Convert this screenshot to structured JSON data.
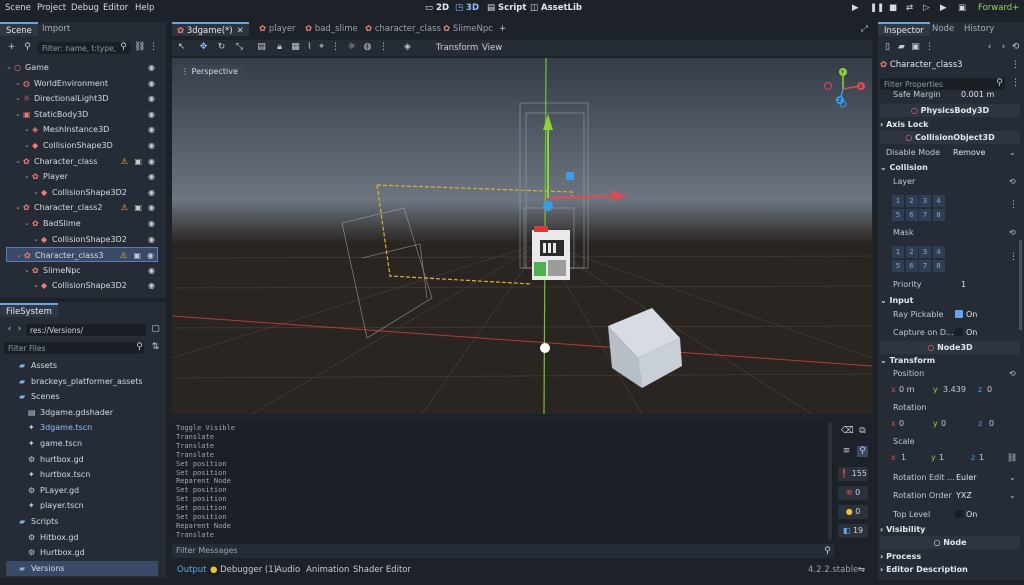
{
  "menu": {
    "items": [
      "Scene",
      "Project",
      "Debug",
      "Editor",
      "Help"
    ]
  },
  "center_buttons": {
    "b2d": "2D",
    "b3d": "3D",
    "script": "Script",
    "assetlib": "AssetLib"
  },
  "renderer": "Forward+",
  "scene_dock": {
    "tabs": [
      "Scene",
      "Import"
    ],
    "filter_placeholder": "Filter: name, t:type,",
    "tree": [
      {
        "label": "Game",
        "indent": 0,
        "icon": "○",
        "color": "#f07b7b"
      },
      {
        "label": "WorldEnvironment",
        "indent": 1,
        "icon": "◍",
        "color": "#f07b7b"
      },
      {
        "label": "DirectionalLight3D",
        "indent": 1,
        "icon": "☼",
        "color": "#f07b7b"
      },
      {
        "label": "StaticBody3D",
        "indent": 1,
        "icon": "▣",
        "color": "#f07b7b"
      },
      {
        "label": "MeshInstance3D",
        "indent": 2,
        "icon": "◈",
        "color": "#f07b7b"
      },
      {
        "label": "CollisionShape3D",
        "indent": 2,
        "icon": "◆",
        "color": "#f07b7b"
      },
      {
        "label": "Character_class",
        "indent": 1,
        "icon": "✿",
        "color": "#f07b7b"
      },
      {
        "label": "Player",
        "indent": 2,
        "icon": "✿",
        "color": "#f07b7b"
      },
      {
        "label": "CollisionShape3D2",
        "indent": 3,
        "icon": "◆",
        "color": "#f07b7b"
      },
      {
        "label": "Character_class2",
        "indent": 1,
        "icon": "✿",
        "color": "#f07b7b"
      },
      {
        "label": "BadSlime",
        "indent": 2,
        "icon": "✿",
        "color": "#f07b7b"
      },
      {
        "label": "CollisionShape3D2",
        "indent": 3,
        "icon": "◆",
        "color": "#f07b7b"
      },
      {
        "label": "Character_class3",
        "indent": 1,
        "icon": "✿",
        "color": "#f07b7b"
      },
      {
        "label": "SlimeNpc",
        "indent": 2,
        "icon": "✿",
        "color": "#f07b7b"
      },
      {
        "label": "CollisionShape3D2",
        "indent": 3,
        "icon": "◆",
        "color": "#f07b7b"
      }
    ]
  },
  "filesystem": {
    "tab": "FileSystem",
    "path": "res://Versions/",
    "filter_placeholder": "Filter Files",
    "items": [
      {
        "label": "Assets",
        "indent": 1,
        "icon": "▰",
        "color": "#7fb2e8"
      },
      {
        "label": "brackeys_platformer_assets",
        "indent": 1,
        "icon": "▰",
        "color": "#7fb2e8"
      },
      {
        "label": "Scenes",
        "indent": 1,
        "icon": "▰",
        "color": "#7fb2e8"
      },
      {
        "label": "3dgame.gdshader",
        "indent": 2,
        "icon": "▤",
        "color": "#c6ccd4"
      },
      {
        "label": "3dgame.tscn",
        "indent": 2,
        "icon": "✦",
        "color": "#c6ccd4"
      },
      {
        "label": "game.tscn",
        "indent": 2,
        "icon": "✦",
        "color": "#c6ccd4"
      },
      {
        "label": "hurtbox.gd",
        "indent": 2,
        "icon": "⚙",
        "color": "#c6ccd4"
      },
      {
        "label": "hurtbox.tscn",
        "indent": 2,
        "icon": "✦",
        "color": "#c6ccd4"
      },
      {
        "label": "PLayer.gd",
        "indent": 2,
        "icon": "⚙",
        "color": "#c6ccd4"
      },
      {
        "label": "player.tscn",
        "indent": 2,
        "icon": "✦",
        "color": "#c6ccd4"
      },
      {
        "label": "Scripts",
        "indent": 1,
        "icon": "▰",
        "color": "#7fb2e8"
      },
      {
        "label": "Hitbox.gd",
        "indent": 2,
        "icon": "⚙",
        "color": "#c6ccd4"
      },
      {
        "label": "Hurtbox.gd",
        "indent": 2,
        "icon": "⚙",
        "color": "#c6ccd4"
      },
      {
        "label": "Versions",
        "indent": 1,
        "icon": "▰",
        "color": "#7fb2e8"
      }
    ]
  },
  "editor_tabs": [
    {
      "label": "3dgame(*)",
      "selected": true
    },
    {
      "label": "player"
    },
    {
      "label": "bad_slime"
    },
    {
      "label": "character_class"
    },
    {
      "label": "SlimeNpc"
    }
  ],
  "toolbar": {
    "transform": "Transform",
    "view": "View"
  },
  "viewport": {
    "perspective": "Perspective",
    "axes": {
      "x": "X",
      "y": "Y",
      "z": "Z"
    }
  },
  "console": {
    "lines": [
      "Toggle Visible",
      "Translate",
      "Translate",
      "Translate",
      "Set position",
      "Set position",
      "Reparent Node",
      "Set position",
      "Set position",
      "Set position",
      "Set position",
      "Reparent Node",
      "Translate"
    ],
    "filter_placeholder": "Filter Messages",
    "counts": {
      "messages": "155",
      "errors": "0",
      "warnings": "0",
      "other": "19"
    }
  },
  "bottom_tabs": [
    "Output",
    "Debugger (1)",
    "Audio",
    "Animation",
    "Shader Editor"
  ],
  "version": "4.2.2.stable",
  "inspector": {
    "tabs": [
      "Inspector",
      "Node",
      "History"
    ],
    "object": "Character_class3",
    "filter_placeholder": "Filter Properties",
    "safe_margin_label": "Safe Margin",
    "safe_margin_value": "0.001 m",
    "physicsbody": "PhysicsBody3D",
    "axis_lock": "Axis Lock",
    "collisionobject": "CollisionObject3D",
    "disable_mode_label": "Disable Mode",
    "disable_mode_value": "Remove",
    "collision": "Collision",
    "layer": "Layer",
    "mask": "Mask",
    "layer_bits": [
      "1",
      "2",
      "3",
      "4",
      "5",
      "6",
      "7",
      "8"
    ],
    "priority_label": "Priority",
    "priority_value": "1",
    "input": "Input",
    "ray_pickable_label": "Ray Pickable",
    "ray_pickable_value": "On",
    "capture_label": "Capture on D...",
    "capture_value": "On",
    "node3d": "Node3D",
    "transform": "Transform",
    "position": "Position",
    "pos": {
      "x": "0 m",
      "y": "3.439",
      "z": "0"
    },
    "rotation": "Rotation",
    "rot": {
      "x": "0",
      "y": "0",
      "z": "0"
    },
    "scale": "Scale",
    "scl": {
      "x": "1",
      "y": "1",
      "z": "1"
    },
    "rot_edit_label": "Rotation Edit ...",
    "rot_edit_value": "Euler",
    "rot_order_label": "Rotation Order",
    "rot_order_value": "YXZ",
    "top_level_label": "Top Level",
    "top_level_value": "On",
    "visibility": "Visibility",
    "node": "Node",
    "process": "Process",
    "editor_description": "Editor Description"
  }
}
